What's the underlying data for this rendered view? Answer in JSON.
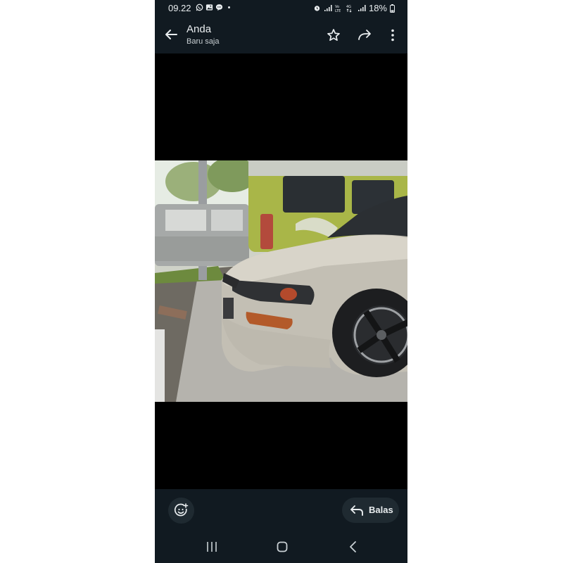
{
  "status_bar": {
    "time": "09.22",
    "battery": "18%",
    "left_icons": [
      "whatsapp-icon",
      "gallery-icon",
      "message-icon",
      "dot-icon"
    ],
    "right_icons": [
      "alarm-icon",
      "signal-icon",
      "volte-icon",
      "data-icon",
      "signal-icon",
      "battery-icon"
    ]
  },
  "header": {
    "title": "Anda",
    "subtitle": "Baru saja",
    "icons": [
      "back-arrow-icon",
      "star-icon",
      "forward-icon",
      "more-vertical-icon"
    ]
  },
  "media": {
    "description_icon": "photo"
  },
  "bottom_bar": {
    "reply_label": "Balas",
    "icons": [
      "add-reaction-icon",
      "reply-icon"
    ]
  },
  "nav_bar": {
    "icons": [
      "recent-apps-icon",
      "home-icon",
      "back-icon"
    ]
  },
  "colors": {
    "bar_background": "#111a21",
    "button_background": "#1f2a31",
    "text_primary": "#e9edef",
    "media_background": "#000000"
  }
}
